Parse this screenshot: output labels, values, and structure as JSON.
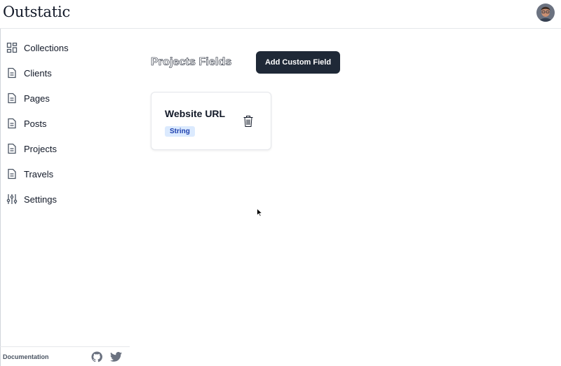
{
  "app": {
    "brand": "Outstatic"
  },
  "user": {
    "avatar_icon": "user-avatar"
  },
  "sidebar": {
    "items": [
      {
        "label": "Collections",
        "icon": "collections-grid-icon"
      },
      {
        "label": "Clients",
        "icon": "document-icon"
      },
      {
        "label": "Pages",
        "icon": "document-icon"
      },
      {
        "label": "Posts",
        "icon": "document-icon"
      },
      {
        "label": "Projects",
        "icon": "document-icon"
      },
      {
        "label": "Travels",
        "icon": "document-icon"
      },
      {
        "label": "Settings",
        "icon": "sliders-icon"
      }
    ],
    "footer": {
      "documentation_label": "Documentation",
      "icons": [
        "github-icon",
        "twitter-icon"
      ]
    }
  },
  "main": {
    "title": "Projects Fields",
    "add_button_label": "Add Custom Field",
    "fields": [
      {
        "name": "Website URL",
        "type": "String"
      }
    ]
  },
  "colors": {
    "button_bg": "#1f2937",
    "badge_bg": "#dbeafe",
    "badge_text": "#1e40af",
    "border": "#e5e7eb"
  }
}
